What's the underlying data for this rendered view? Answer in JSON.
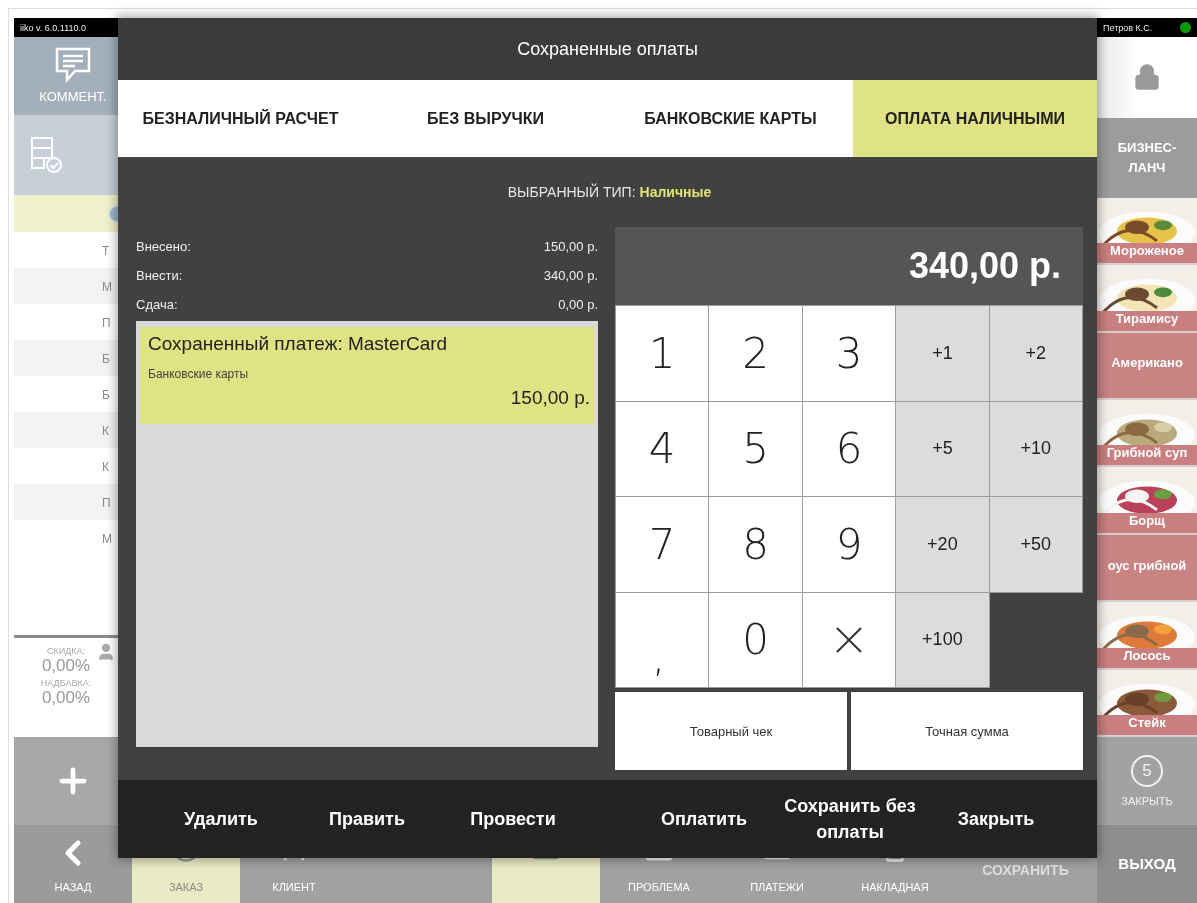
{
  "app": {
    "version": "iiko v. 6.0.1110.0",
    "user": "Петров К.С.",
    "user_online": true
  },
  "left_panel": {
    "comment_button": "КОММЕНТ.",
    "order_rows": [
      {
        "text": "Т"
      },
      {
        "text": "М"
      },
      {
        "text": "П"
      },
      {
        "text": "Б"
      },
      {
        "text": "Б"
      },
      {
        "text": "К"
      },
      {
        "text": "К"
      },
      {
        "text": "П"
      },
      {
        "text": "М"
      }
    ],
    "discount_label": "СКИДКА:",
    "discount": "0,00%",
    "markup_label": "НАДБАВКА:",
    "markup": "0,00%"
  },
  "right_panel": {
    "category": "БИЗНЕС-ЛАНЧ",
    "products": [
      {
        "name": "Мороженое"
      },
      {
        "name": "Тирамису"
      },
      {
        "name": "Американо",
        "kind": "plain"
      },
      {
        "name": "Грибной суп"
      },
      {
        "name": "Борщ"
      },
      {
        "name": "оус грибной",
        "kind": "plain"
      },
      {
        "name": "Лосось"
      },
      {
        "name": "Стейк"
      }
    ],
    "close_count": "5",
    "close_label": "ЗАКРЫТЬ",
    "exit": "ВЫХОД"
  },
  "bottom_bar": {
    "back": "НАЗАД",
    "items": [
      {
        "label": "ЗАКАЗ",
        "kind": "order",
        "selected": true,
        "disabled": false
      },
      {
        "label": "КЛИЕНТ",
        "kind": "client",
        "selected": false,
        "disabled": false
      },
      {
        "kind": "spacer"
      },
      {
        "kind": "keyboard",
        "selected": true,
        "disabled": false
      },
      {
        "label": "ПРОБЛЕМА",
        "kind": "problem",
        "selected": false,
        "disabled": false
      },
      {
        "label": "ПЛАТЕЖИ",
        "kind": "payments",
        "selected": false,
        "disabled": false
      },
      {
        "label": "НАКЛАДНАЯ",
        "kind": "invoice",
        "selected": false,
        "disabled": false
      },
      {
        "label": "СОХРАНИТЬ",
        "kind": "save",
        "selected": false,
        "disabled": true
      }
    ]
  },
  "dialog": {
    "title": "Сохраненные оплаты",
    "tabs": [
      {
        "label": "БЕЗНАЛИЧНЫЙ РАСЧЕТ",
        "selected": false
      },
      {
        "label": "БЕЗ ВЫРУЧКИ",
        "selected": false
      },
      {
        "label": "БАНКОВСКИЕ КАРТЫ",
        "selected": false
      },
      {
        "label": "ОПЛАТА НАЛИЧНЫМИ",
        "selected": true
      }
    ],
    "selected_type_label": "ВЫБРАННЫЙ ТИП:",
    "selected_type": "Наличные",
    "totals": [
      {
        "label": "Внесено:",
        "value": "150,00 р."
      },
      {
        "label": "Внести:",
        "value": "340,00 р."
      },
      {
        "label": "Сдача:",
        "value": "0,00 р."
      }
    ],
    "saved_payments": [
      {
        "title": "Сохраненный платеж: MasterCard",
        "type": "Банковские карты",
        "amount": "150,00 р.",
        "selected": true
      }
    ],
    "display": "340,00 р.",
    "keys": [
      {
        "label": "1",
        "kind": "digit"
      },
      {
        "label": "2",
        "kind": "digit"
      },
      {
        "label": "3",
        "kind": "digit"
      },
      {
        "label": "+1",
        "kind": "add"
      },
      {
        "label": "+2",
        "kind": "add"
      },
      {
        "label": "4",
        "kind": "digit"
      },
      {
        "label": "5",
        "kind": "digit"
      },
      {
        "label": "6",
        "kind": "digit"
      },
      {
        "label": "+5",
        "kind": "add"
      },
      {
        "label": "+10",
        "kind": "add"
      },
      {
        "label": "7",
        "kind": "digit"
      },
      {
        "label": "8",
        "kind": "digit"
      },
      {
        "label": "9",
        "kind": "digit"
      },
      {
        "label": "+20",
        "kind": "add"
      },
      {
        "label": "+50",
        "kind": "add"
      },
      {
        "label": ",",
        "kind": "comma"
      },
      {
        "label": "0",
        "kind": "digit"
      },
      {
        "kind": "clear"
      },
      {
        "label": "+100",
        "kind": "add"
      },
      {
        "kind": "blank"
      }
    ],
    "extra_buttons": [
      "Товарный чек",
      "Точная сумма"
    ],
    "actions": [
      "Удалить",
      "Править",
      "Провести",
      "Оплатить",
      "Сохранить без оплаты",
      "Закрыть"
    ]
  }
}
